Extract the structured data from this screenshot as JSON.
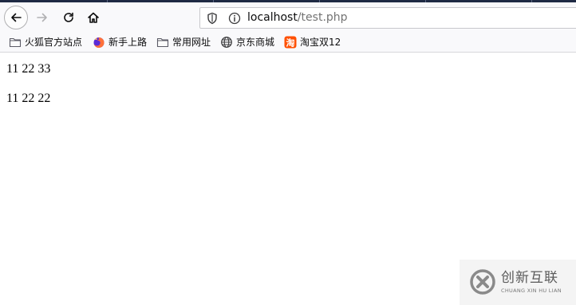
{
  "browser": {
    "url_host": "localhost",
    "url_path": "/test.php",
    "nav_icons": [
      "back-arrow-icon",
      "forward-arrow-icon",
      "reload-icon",
      "home-icon"
    ],
    "url_icons": [
      "shield-icon",
      "info-icon"
    ]
  },
  "bookmarks": [
    {
      "label": "火狐官方站点",
      "icon": "folder-icon"
    },
    {
      "label": "新手上路",
      "icon": "firefox-icon"
    },
    {
      "label": "常用网址",
      "icon": "folder-icon"
    },
    {
      "label": "京东商城",
      "icon": "globe-icon"
    },
    {
      "label": "淘宝双12",
      "icon": "taobao-icon"
    }
  ],
  "page": {
    "lines": [
      "11 22 33",
      "11 22 22"
    ]
  },
  "watermark": {
    "title": "创新互联",
    "subtitle": "CHUANG XIN HU LIAN"
  },
  "colors": {
    "toolbar": "#f9f9fb",
    "taobao": "#ff5000",
    "firefox": "#ff7139"
  }
}
